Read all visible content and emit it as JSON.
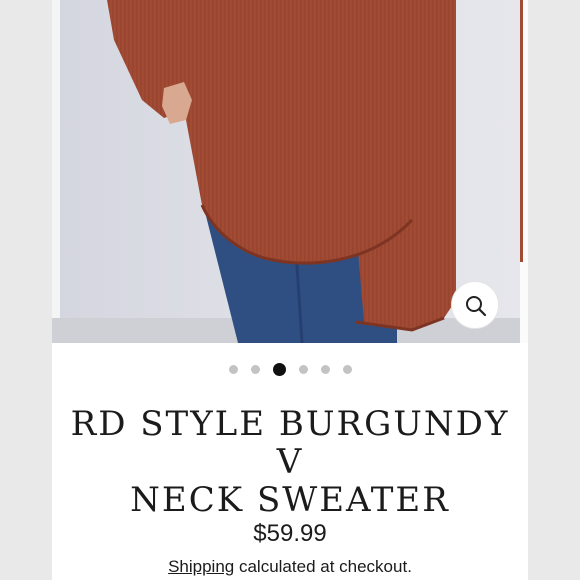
{
  "product": {
    "title_line1": "RD STYLE BURGUNDY V",
    "title_line2": "NECK SWEATER",
    "price": "$59.99",
    "shipping_link": "Shipping",
    "shipping_rest": " calculated at checkout."
  },
  "gallery": {
    "image_count": 6,
    "active_index": 2,
    "zoom_icon": "magnifier-icon",
    "colors": {
      "sweater": "#a14a34",
      "jeans": "#2f4f83",
      "wall": "#dadce4"
    }
  }
}
